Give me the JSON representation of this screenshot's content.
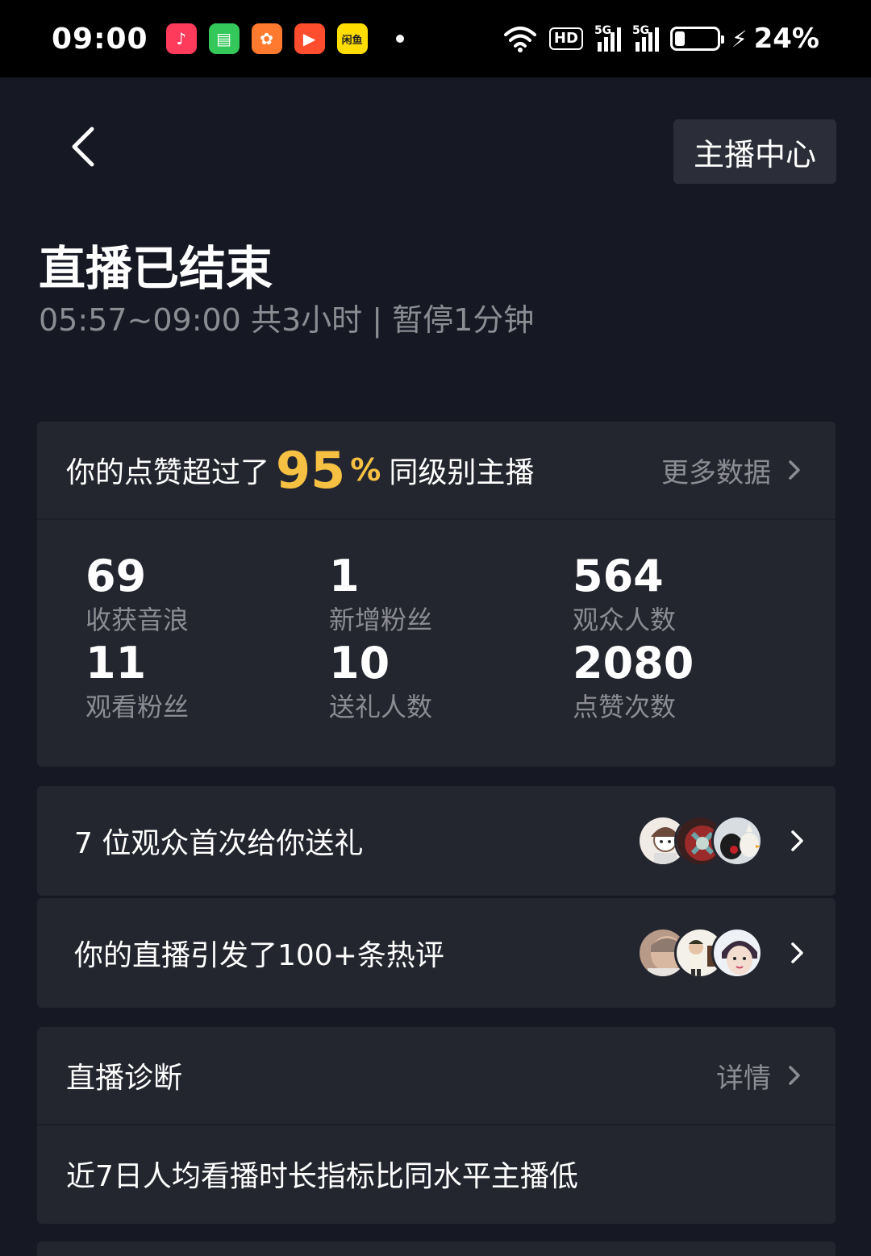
{
  "status_bar": {
    "time": "09:00",
    "apps": [
      {
        "icon": "music-app-icon",
        "color": "#ff3b5c",
        "glyph": "♪"
      },
      {
        "icon": "messages-app-icon",
        "color": "#34c759",
        "glyph": "▤"
      },
      {
        "icon": "orange-app-icon",
        "color": "#ff7a2f",
        "glyph": "✿"
      },
      {
        "icon": "video-app-icon",
        "color": "#ff4d2e",
        "glyph": "▶"
      },
      {
        "icon": "xianyu-app-icon",
        "color": "#ffdd00",
        "glyph": "闲鱼"
      }
    ],
    "hd_label": "HD",
    "network_1": "5G",
    "network_2": "5G",
    "battery_level": 0.24,
    "battery_text": "24%"
  },
  "header": {
    "back_label": "<",
    "center_button": "主播中心"
  },
  "summary": {
    "title": "直播已结束",
    "subtitle": "05:57~09:00 共3小时 | 暂停1分钟"
  },
  "stats_card": {
    "prefix": "你的点赞超过了",
    "percent_value": "95",
    "percent_symbol": "%",
    "suffix": "同级别主播",
    "more_link": "更多数据",
    "stats": [
      {
        "value": "69",
        "label": "收获音浪"
      },
      {
        "value": "1",
        "label": "新增粉丝"
      },
      {
        "value": "564",
        "label": "观众人数"
      },
      {
        "value": "11",
        "label": "观看粉丝"
      },
      {
        "value": "10",
        "label": "送礼人数"
      },
      {
        "value": "2080",
        "label": "点赞次数"
      }
    ]
  },
  "rows": {
    "gift": {
      "text": "7 位观众首次给你送礼"
    },
    "hot": {
      "text": "你的直播引发了100+条热评"
    }
  },
  "diagnosis": {
    "title": "直播诊断",
    "detail_link": "详情",
    "message": "近7日人均看播时长指标比同水平主播低"
  },
  "colors": {
    "background": "#161823",
    "card": "#24262f",
    "accent": "#f6c042",
    "muted_text": "#8c8d93"
  }
}
